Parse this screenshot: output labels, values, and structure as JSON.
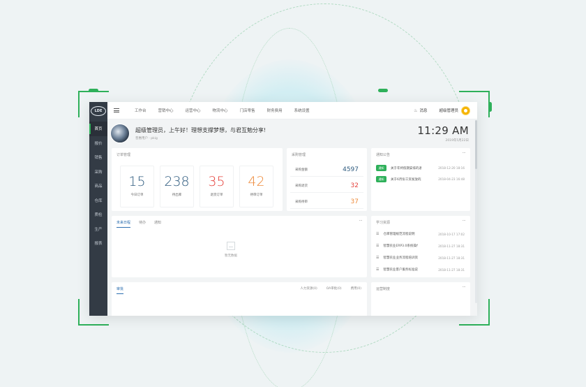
{
  "colors": {
    "brand_green": "#2eb05a",
    "sidebar_bg": "#333b45",
    "stat_blue": "#2d5a7e",
    "stat_red": "#e5413b",
    "stat_orange": "#ee8a3a"
  },
  "sidebar": {
    "logo": "LDE",
    "items": [
      {
        "label": "首页",
        "active": true
      },
      {
        "label": "报价"
      },
      {
        "label": "销售"
      },
      {
        "label": "采购"
      },
      {
        "label": "商品"
      },
      {
        "label": "仓库"
      },
      {
        "label": "质检"
      },
      {
        "label": "生产"
      },
      {
        "label": "报表"
      }
    ]
  },
  "topbar": {
    "menu": [
      "工作台",
      "营销中心",
      "运营中心",
      "物流中心",
      "门店零售",
      "财务费用",
      "系统设置"
    ],
    "message_label": "消息",
    "user_name": "超级管理员",
    "icons": {
      "menu": "menu-icon",
      "bell": "bell-icon",
      "avatar": "user-avatar-icon"
    }
  },
  "welcome": {
    "greeting": "超级管理员，上午好！理想支撑梦想，与君互勉分享!",
    "sub": "普惠用户 · pkig",
    "time": "11:29 AM",
    "date": "2019年5月22日"
  },
  "order_card": {
    "title": "订单管理",
    "stats": [
      {
        "value": "15",
        "label": "今日订单",
        "color": "#2d5a7e"
      },
      {
        "value": "238",
        "label": "待出库",
        "color": "#2d5a7e"
      },
      {
        "value": "35",
        "label": "退货订单",
        "color": "#e5413b"
      },
      {
        "value": "42",
        "label": "待审订单",
        "color": "#ee8a3a"
      }
    ]
  },
  "purchase_card": {
    "title": "采购管理",
    "rows": [
      {
        "label": "采购金额",
        "value": "4597",
        "color": "#2d5a7e"
      },
      {
        "label": "采购退货",
        "value": "32",
        "color": "#e5413b"
      },
      {
        "label": "采购待审",
        "value": "37",
        "color": "#ee8a3a"
      }
    ]
  },
  "notice_card": {
    "title": "通知公告",
    "more": "···",
    "items": [
      {
        "tag": "通知",
        "text": "关于年终假期安排的通知",
        "date": "2018-12-20 18:16"
      },
      {
        "tag": "通知",
        "text": "关于6月份工资发放的通知",
        "date": "2018-04-23 16:48"
      }
    ]
  },
  "task_card": {
    "tabs": [
      "未来日程",
      "待办",
      "通知"
    ],
    "more": "···",
    "empty_text": "暂无数据"
  },
  "study_card": {
    "title": "学习资源",
    "more": "···",
    "items": [
      {
        "text": "仓库管理规范流程说明",
        "date": "2018-10-17 17:02"
      },
      {
        "text": "智慧农业ERP3.0系统操作手册",
        "date": "2018-11-27 18:31"
      },
      {
        "text": "智慧农业业务流程培训资料",
        "date": "2018-11-27 18:31"
      },
      {
        "text": "智慧农业客户服务标准说明",
        "date": "2018-11-27 18:31"
      }
    ]
  },
  "approval_card": {
    "title": "审批",
    "tabs": [
      "人力资源(0)",
      "OA审批(0)",
      "费用(0)"
    ]
  },
  "rules_card": {
    "title": "运营制度",
    "more": "···"
  }
}
